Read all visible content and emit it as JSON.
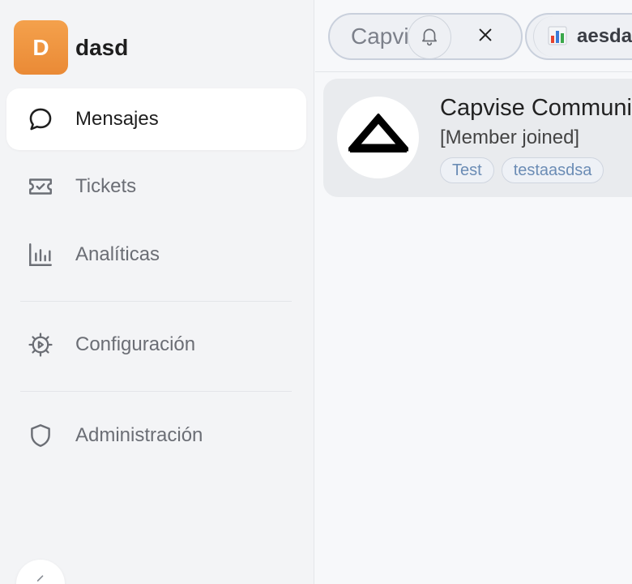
{
  "workspace": {
    "initial": "D",
    "name": "dasd",
    "accent": "#ee9140"
  },
  "nav": [
    {
      "label": "Mensajes",
      "icon": "chat-bubble-icon",
      "active": true
    },
    {
      "label": "Tickets",
      "icon": "ticket-icon"
    },
    {
      "label": "Analíticas",
      "icon": "bar-chart-icon"
    },
    {
      "label": "Configuración",
      "icon": "gear-icon"
    },
    {
      "label": "Administración",
      "icon": "shield-icon"
    }
  ],
  "tabs": [
    {
      "label": "Capvise Community"
    },
    {
      "label": "aesdasd",
      "icon": "bar-chart-emoji-icon"
    }
  ],
  "chat": {
    "title": "Capvise Community",
    "subtitle": "[Member joined]",
    "tags": [
      "Test",
      "testaasdsa"
    ]
  }
}
